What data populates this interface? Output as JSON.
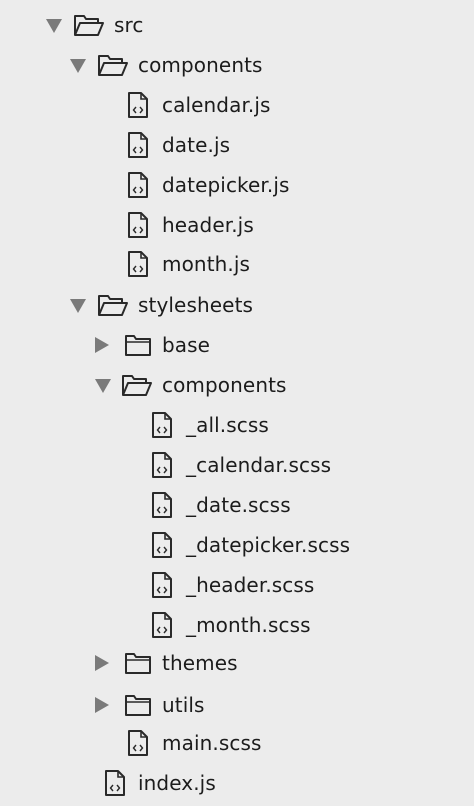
{
  "tree": {
    "src": {
      "label": "src",
      "icon": "folder-open-icon",
      "state": "expanded"
    },
    "components": {
      "label": "components",
      "icon": "folder-open-icon",
      "state": "expanded",
      "files": [
        "calendar.js",
        "date.js",
        "datepicker.js",
        "header.js",
        "month.js"
      ]
    },
    "stylesheets": {
      "label": "stylesheets",
      "icon": "folder-open-icon",
      "state": "expanded",
      "base": {
        "label": "base",
        "icon": "folder-closed-icon",
        "state": "collapsed"
      },
      "components": {
        "label": "components",
        "icon": "folder-open-icon",
        "state": "expanded",
        "files": [
          "_all.scss",
          "_calendar.scss",
          "_date.scss",
          "_datepicker.scss",
          "_header.scss",
          "_month.scss"
        ]
      },
      "themes": {
        "label": "themes",
        "icon": "folder-closed-icon",
        "state": "collapsed"
      },
      "utils": {
        "label": "utils",
        "icon": "folder-closed-icon",
        "state": "collapsed"
      },
      "main": {
        "label": "main.scss",
        "icon": "code-file-icon"
      }
    },
    "index": {
      "label": "index.js",
      "icon": "code-file-icon"
    }
  },
  "colors": {
    "background": "#ececec",
    "text": "#1c1c1c",
    "arrow": "#7a7a7a",
    "icon_stroke": "#2a2a2a"
  }
}
